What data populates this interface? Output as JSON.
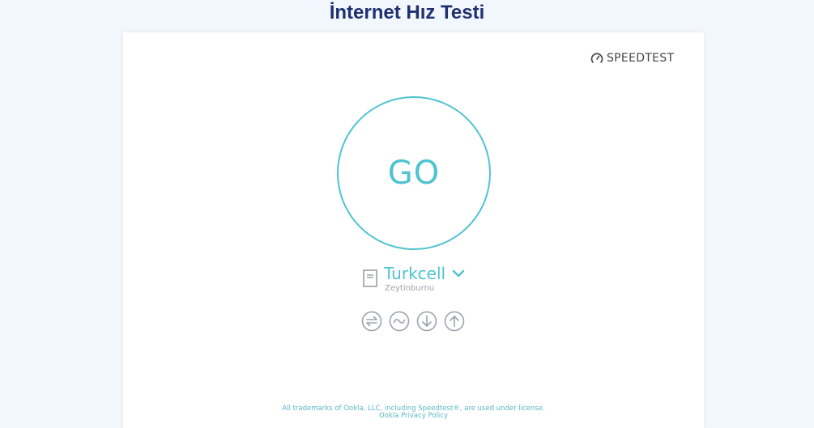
{
  "page": {
    "title": "İnternet Hız Testi"
  },
  "brand": {
    "name": "SPEEDTEST",
    "icon": "speedometer-icon"
  },
  "go_button": {
    "label": "GO"
  },
  "server": {
    "icon": "server-icon",
    "provider": "Turkcell",
    "location": "Zeytinburnu",
    "dropdown_icon": "chevron-down-icon"
  },
  "metrics_icons": [
    "ping-icon",
    "jitter-icon",
    "download-icon",
    "upload-icon"
  ],
  "footer": {
    "trademark": "All trademarks of Ookla, LLC, including Speedtest®, are used under license.",
    "privacy_link": "Ookla Privacy Policy"
  },
  "colors": {
    "background": "#f2f6fd",
    "title": "#1f3170",
    "accent": "#4fc3d0",
    "card": "#ffffff",
    "muted": "#9aa3ad"
  }
}
